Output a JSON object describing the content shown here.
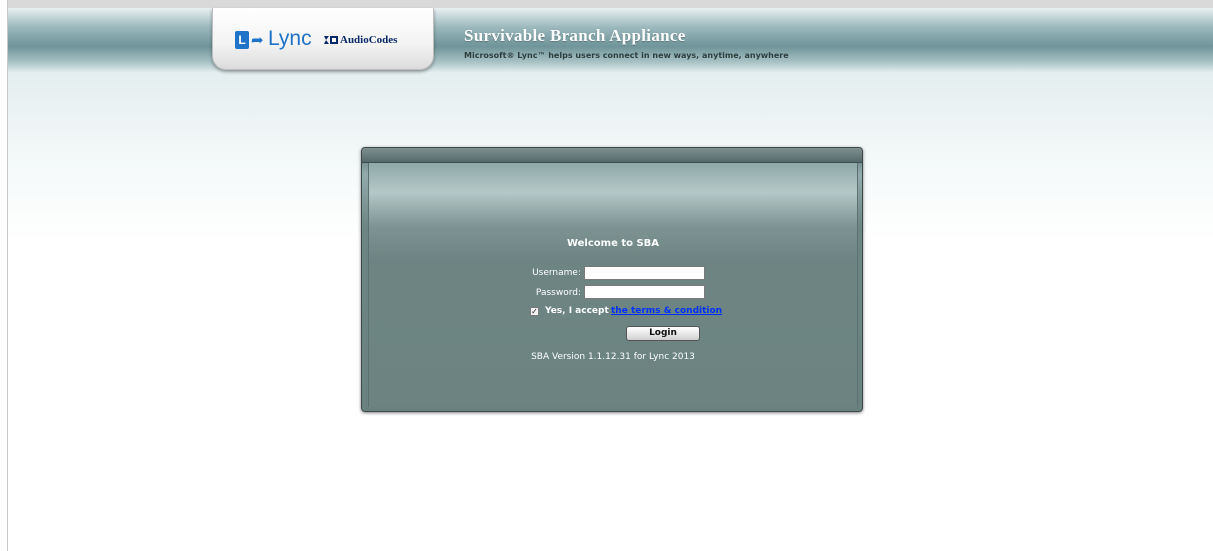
{
  "header": {
    "product_name": "Lync",
    "vendor_name": "AudioCodes",
    "title": "Survivable Branch Appliance",
    "tagline": "Microsoft® Lync™ helps users connect in new ways, anytime, anywhere"
  },
  "login": {
    "welcome": "Welcome to SBA",
    "username_label": "Username:",
    "username_value": "",
    "password_label": "Password:",
    "password_value": "",
    "accept_checked": true,
    "accept_text": "Yes, I accept",
    "terms_link": "the terms & condition",
    "login_button": "Login",
    "version": "SBA Version 1.1.12.31 for Lync 2013"
  },
  "colors": {
    "lync_blue": "#1f73c8",
    "audiocodes_navy": "#0a2a6a",
    "panel_bg": "#6c8382",
    "link": "#0030ff"
  },
  "icons": [
    "lync-logo-icon",
    "audiocodes-logo-icon",
    "checkbox-checked-icon"
  ]
}
